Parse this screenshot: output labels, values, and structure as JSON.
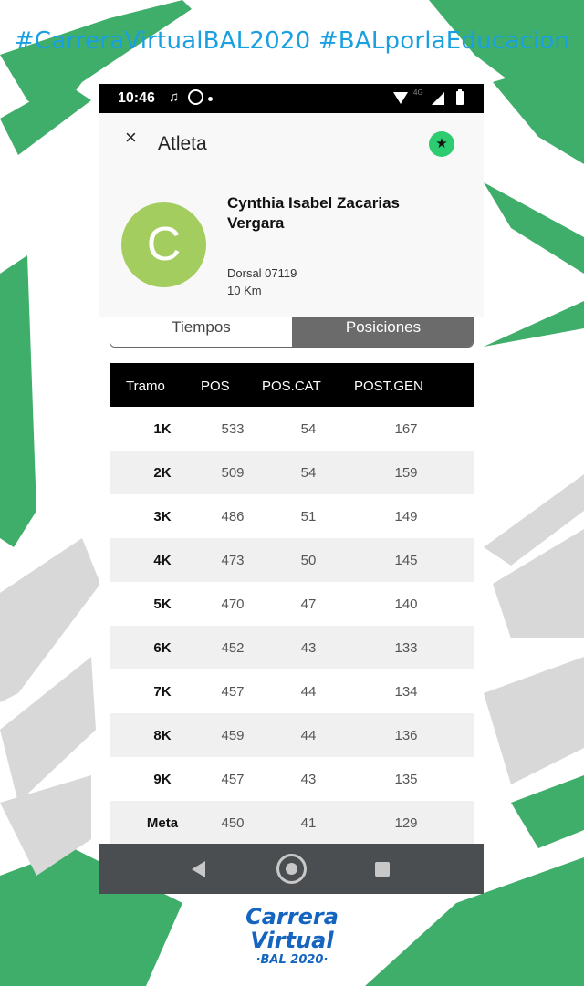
{
  "hashtags": "#CarreraVirtualBAL2020 #BALporlaEducacion",
  "colors": {
    "brand_blue": "#1565c0",
    "hashtag_blue": "#1aa0e0",
    "brush_green": "#3fae6a",
    "avatar_green": "#a3cd5f",
    "star_green": "#2ecc71"
  },
  "status_bar": {
    "time": "10:46",
    "network": "4G",
    "icons": [
      "music-note-icon",
      "whatsapp-icon",
      "wifi-icon",
      "signal-icon",
      "battery-icon"
    ]
  },
  "app_bar": {
    "title": "Atleta",
    "close_icon": "×",
    "star_icon": "★"
  },
  "athlete": {
    "avatar_letter": "C",
    "name": "Cynthia Isabel Zacarias Vergara",
    "dorsal": "Dorsal 07119",
    "distance": "10 Km"
  },
  "tabs": [
    {
      "label": "Tiempos",
      "active": false
    },
    {
      "label": "Posiciones",
      "active": true
    }
  ],
  "table": {
    "headers": [
      "Tramo",
      "POS",
      "POS.CAT",
      "POST.GEN"
    ],
    "rows": [
      [
        "1K",
        "533",
        "54",
        "167"
      ],
      [
        "2K",
        "509",
        "54",
        "159"
      ],
      [
        "3K",
        "486",
        "51",
        "149"
      ],
      [
        "4K",
        "473",
        "50",
        "145"
      ],
      [
        "5K",
        "470",
        "47",
        "140"
      ],
      [
        "6K",
        "452",
        "43",
        "133"
      ],
      [
        "7K",
        "457",
        "44",
        "134"
      ],
      [
        "8K",
        "459",
        "44",
        "136"
      ],
      [
        "9K",
        "457",
        "43",
        "135"
      ],
      [
        "Meta",
        "450",
        "41",
        "129"
      ]
    ]
  },
  "nav_bar": {
    "icons": [
      "back-icon",
      "home-icon",
      "recent-apps-icon"
    ]
  },
  "logo": {
    "line1": "Carrera",
    "line2": "Virtual",
    "line3": "·BAL 2020·"
  }
}
